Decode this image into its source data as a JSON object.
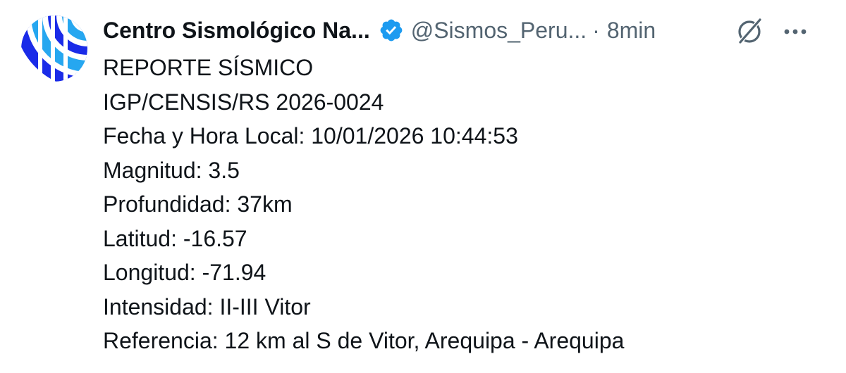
{
  "author": {
    "display_name": "Centro Sismológico Na...",
    "handle": "@Sismos_Peru...",
    "separator": "·",
    "time": "8min",
    "avatar_icon": "seismic-logo-icon",
    "verified_icon": "verified-badge-icon",
    "verified_color": "#1d9bf0"
  },
  "actions": {
    "grok_icon": "grok-icon",
    "more_icon": "more-options-icon"
  },
  "tweet": {
    "lines": [
      "REPORTE SÍSMICO",
      "IGP/CENSIS/RS 2026-0024",
      "Fecha y Hora Local: 10/01/2026 10:44:53",
      "Magnitud: 3.5",
      "Profundidad: 37km",
      "Latitud: -16.57",
      "Longitud: -71.94",
      "Intensidad: II-III Vitor",
      "Referencia: 12 km al S de Vitor, Arequipa - Arequipa"
    ]
  },
  "colors": {
    "text_primary": "#0f1419",
    "text_secondary": "#536471",
    "logo_dark_blue": "#1a2be8",
    "logo_light_blue": "#26a7f0"
  }
}
